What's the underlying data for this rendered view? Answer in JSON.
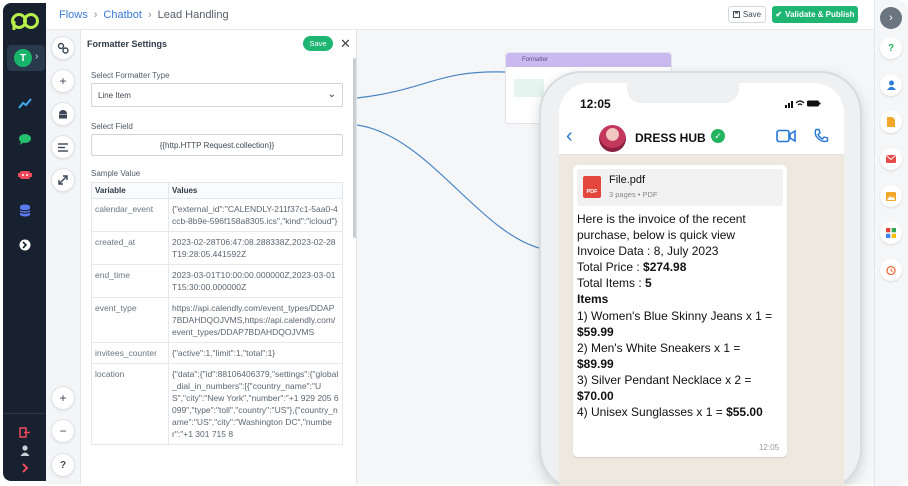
{
  "breadcrumb": {
    "root": "Flows",
    "parent": "Chatbot",
    "current": "Lead Handling"
  },
  "header": {
    "save_label": "Save",
    "validate_label": "Validate & Publish"
  },
  "user": {
    "initial": "T"
  },
  "panel": {
    "title": "Formatter Settings",
    "save_label": "Save",
    "formatter_type_label": "Select Formatter Type",
    "formatter_type_value": "Line Item",
    "field_label": "Select Field",
    "field_value": "{{http.HTTP Request.collection}}",
    "sample_label": "Sample Value",
    "table_headers": [
      "Variable",
      "Values"
    ],
    "rows": [
      {
        "k": "calendar_event",
        "v": "{\"external_id\":\"CALENDLY-211f37c1-5aa0-4ccb-8b9e-596f158a8305.ics\",\"kind\":\"icloud\"}"
      },
      {
        "k": "created_at",
        "v": "2023-02-28T06:47:08.288338Z,2023-02-28T19:28:05.441592Z"
      },
      {
        "k": "end_time",
        "v": "2023-03-01T10:00:00.000000Z,2023-03-01T15:30:00.000000Z"
      },
      {
        "k": "event_type",
        "v": "https://api.calendly.com/event_types/DDAP7BDAHDQOJVMS,https://api.calendly.com/event_types/DDAP7BDAHDQOJVMS"
      },
      {
        "k": "invitees_counter",
        "v": "{\"active\":1,\"limit\":1,\"total\":1}"
      },
      {
        "k": "location",
        "v": "{\"data\":{\"id\":88106406379,\"settings\":{\"global_dial_in_numbers\":[{\"country_name\":\"US\",\"city\":\"New York\",\"number\":\"+1 929 205 6099\",\"type\":\"toll\",\"country\":\"US\"},{\"country_name\":\"US\",\"city\":\"Washington DC\",\"number\":\"+1 301 715 8"
      }
    ]
  },
  "node": {
    "title": "Formatter"
  },
  "phone": {
    "time": "12:05",
    "business_name": "DRESS HUB",
    "file_name": "File.pdf",
    "file_meta": "3 pages • PDF",
    "pdf_badge": "PDF",
    "message_time": "12:05",
    "lines": [
      {
        "t": "Here is the invoice of the recent"
      },
      {
        "t": "purchase, below is quick view"
      },
      {
        "t": " "
      },
      {
        "t": "Invoice Data : 8, July 2023"
      },
      {
        "t": "Total Price : ",
        "b": "$274.98"
      },
      {
        "t": "Total Items : ",
        "b": "5"
      },
      {
        "t": "",
        "b": "Items"
      },
      {
        "t": "1) Women's Blue Skinny Jeans x 1 ="
      },
      {
        "t": "",
        "b": "$59.99"
      },
      {
        "t": "2) Men's White Sneakers x 1 ="
      },
      {
        "t": "",
        "b": "$89.99"
      },
      {
        "t": "3) Silver Pendant Necklace x 2 ="
      },
      {
        "t": "",
        "b": "$70.00"
      },
      {
        "t": "4) Unisex Sunglasses x 1 = ",
        "b": "$55.00"
      }
    ]
  },
  "colors": {
    "accent": "#1fb573",
    "nav_bg": "#17212f",
    "link": "#3a7bd5",
    "chat_bg": "#efe8de"
  }
}
